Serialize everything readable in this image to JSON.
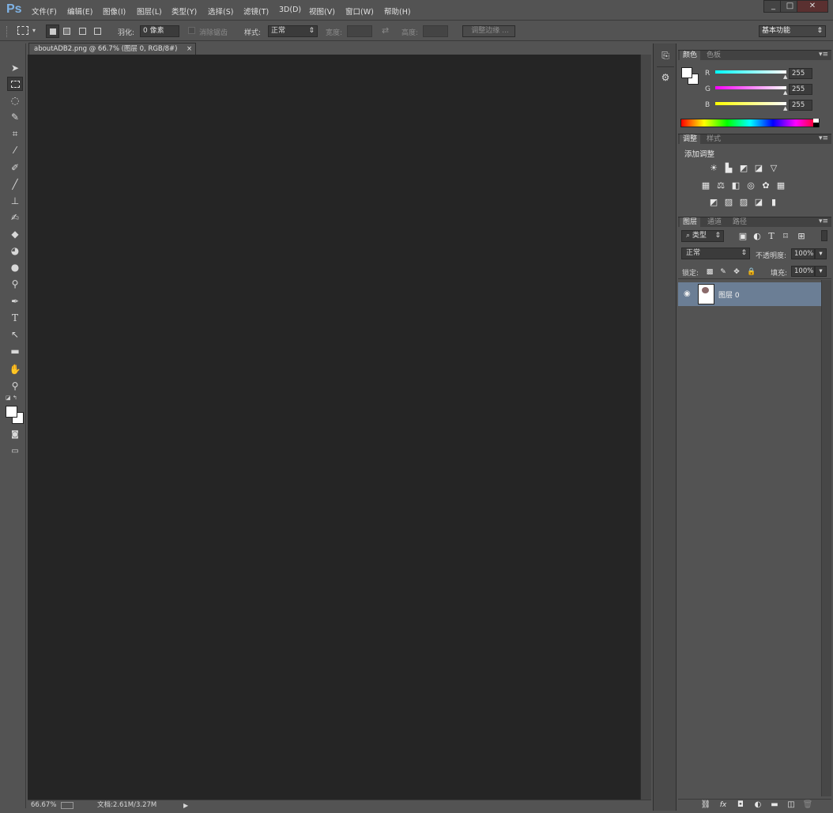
{
  "app": {
    "logo": "Ps"
  },
  "menu": [
    {
      "label": "文件(F)"
    },
    {
      "label": "编辑(E)"
    },
    {
      "label": "图像(I)"
    },
    {
      "label": "图层(L)"
    },
    {
      "label": "类型(Y)"
    },
    {
      "label": "选择(S)"
    },
    {
      "label": "滤镜(T)"
    },
    {
      "label": "3D(D)"
    },
    {
      "label": "视图(V)"
    },
    {
      "label": "窗口(W)"
    },
    {
      "label": "帮助(H)"
    }
  ],
  "window_controls": {
    "minimize": "_",
    "restore": "□",
    "close": "✕"
  },
  "options": {
    "feather_label": "羽化:",
    "feather_value": "0 像素",
    "antialias_label": "消除锯齿",
    "style_label": "样式:",
    "style_value": "正常",
    "width_label": "宽度:",
    "height_label": "高度:",
    "refine_edge": "调整边缘 ...",
    "workspace": "基本功能"
  },
  "document": {
    "tab_title": "aboutADB2.png @ 66.7% (图层 0, RGB/8#)",
    "close": "×",
    "zoom": "66.67%",
    "doc_size": "文档:2.61M/3.27M"
  },
  "color_panel": {
    "tabs": [
      "颜色",
      "色板"
    ],
    "channels": [
      {
        "label": "R",
        "value": "255",
        "color": "#00e5ee"
      },
      {
        "label": "G",
        "value": "255",
        "color": "#e01fe0"
      },
      {
        "label": "B",
        "value": "255",
        "color": "#eeee22"
      }
    ]
  },
  "adjust_panel": {
    "tabs": [
      "调整",
      "样式"
    ],
    "title": "添加调整"
  },
  "layers_panel": {
    "tabs": [
      "图层",
      "通道",
      "路径"
    ],
    "filter_label": "类型",
    "blend_mode": "正常",
    "opacity_label": "不透明度:",
    "opacity_value": "100%",
    "lock_label": "锁定:",
    "fill_label": "填充:",
    "fill_value": "100%",
    "layers": [
      {
        "name": "图层 0"
      }
    ]
  },
  "colors": {
    "accent_selected_layer": "#6b7e95",
    "canvas_bg": "#252525"
  }
}
